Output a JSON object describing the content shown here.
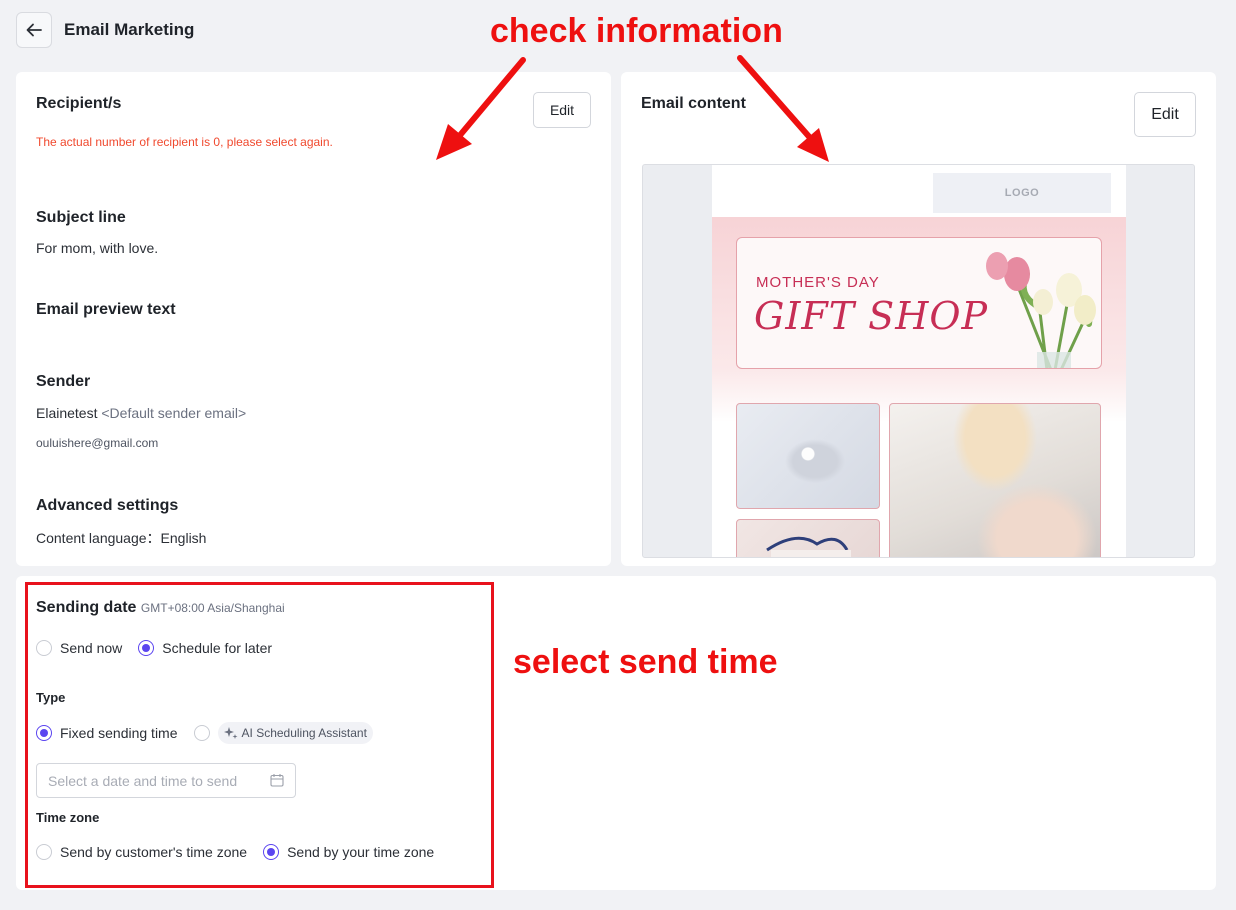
{
  "header": {
    "title": "Email Marketing",
    "back_icon": "arrow-left-icon"
  },
  "recipients": {
    "title": "Recipient/s",
    "edit_label": "Edit",
    "warning": "The actual number of recipient is 0, please select again."
  },
  "subject": {
    "title": "Subject line",
    "value": "For mom, with love."
  },
  "preview_text": {
    "title": "Email preview text"
  },
  "sender": {
    "title": "Sender",
    "name": "Elainetest",
    "tag": "<Default sender email>",
    "email": "ouluishere@gmail.com"
  },
  "advanced": {
    "title": "Advanced settings",
    "language_label": "Content language：",
    "language_value": "English"
  },
  "email_content": {
    "title": "Email content",
    "edit_label": "Edit",
    "logo_text": "LOGO",
    "banner_sub": "MOTHER'S DAY",
    "banner_main": "GIFT SHOP"
  },
  "sending": {
    "title": "Sending date",
    "timezone_note": "GMT+08:00 Asia/Shanghai",
    "options": [
      {
        "label": "Send now",
        "selected": false
      },
      {
        "label": "Schedule for later",
        "selected": true
      }
    ],
    "type_label": "Type",
    "type_options": [
      {
        "label": "Fixed sending time",
        "selected": true
      },
      {
        "label": "AI Scheduling Assistant",
        "selected": false
      }
    ],
    "date_placeholder": "Select a date and time to send",
    "timezone_label": "Time zone",
    "timezone_options": [
      {
        "label": "Send by customer's time zone",
        "selected": false
      },
      {
        "label": "Send by your time zone",
        "selected": true
      }
    ]
  },
  "annotations": {
    "check_information": "check information",
    "select_send_time": "select send time"
  },
  "colors": {
    "accent": "#5b45f0",
    "warning": "#f0492e",
    "annotation": "#ee1010",
    "background": "#f1f2f5"
  }
}
